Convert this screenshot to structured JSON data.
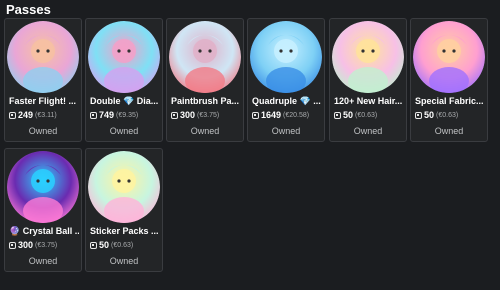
{
  "section_title": "Passes",
  "currency_icon": "robux-icon",
  "passes": [
    {
      "name": "Faster Flight! ...",
      "price": "249",
      "local_price": "(€3.11)",
      "status": "Owned",
      "colors": [
        "#e9a6d6",
        "#8fd0f0",
        "#f7c1a1"
      ]
    },
    {
      "name": "Double 💎 Dia...",
      "price": "749",
      "local_price": "(€9.35)",
      "status": "Owned",
      "colors": [
        "#7fe0f5",
        "#d6a0f0",
        "#f5a0c8"
      ]
    },
    {
      "name": "Paintbrush Pa...",
      "price": "300",
      "local_price": "(€3.75)",
      "status": "Owned",
      "colors": [
        "#cfe6f5",
        "#f27a86",
        "#e0b0c8"
      ]
    },
    {
      "name": "Quadruple 💎 ...",
      "price": "1649",
      "local_price": "(€20.58)",
      "status": "Owned",
      "colors": [
        "#7ed0f5",
        "#3a8ee6",
        "#c7f0ff"
      ]
    },
    {
      "name": "120+ New Hair...",
      "price": "50",
      "local_price": "(€0.63)",
      "status": "Owned",
      "colors": [
        "#f7c0e6",
        "#c0f0d0",
        "#ffe39a"
      ]
    },
    {
      "name": "Special Fabric...",
      "price": "50",
      "local_price": "(€0.63)",
      "status": "Owned",
      "colors": [
        "#ff9fd0",
        "#a070ff",
        "#ffd0a0"
      ]
    },
    {
      "name": "🔮 Crystal Ball ...",
      "price": "300",
      "local_price": "(€3.75)",
      "status": "Owned",
      "colors": [
        "#6a2bb0",
        "#ff7ad6",
        "#2ad0ff"
      ]
    },
    {
      "name": "Sticker Packs ...",
      "price": "50",
      "local_price": "(€0.63)",
      "status": "Owned",
      "colors": [
        "#c7f5e0",
        "#ffb3d9",
        "#fff3a0"
      ]
    }
  ]
}
